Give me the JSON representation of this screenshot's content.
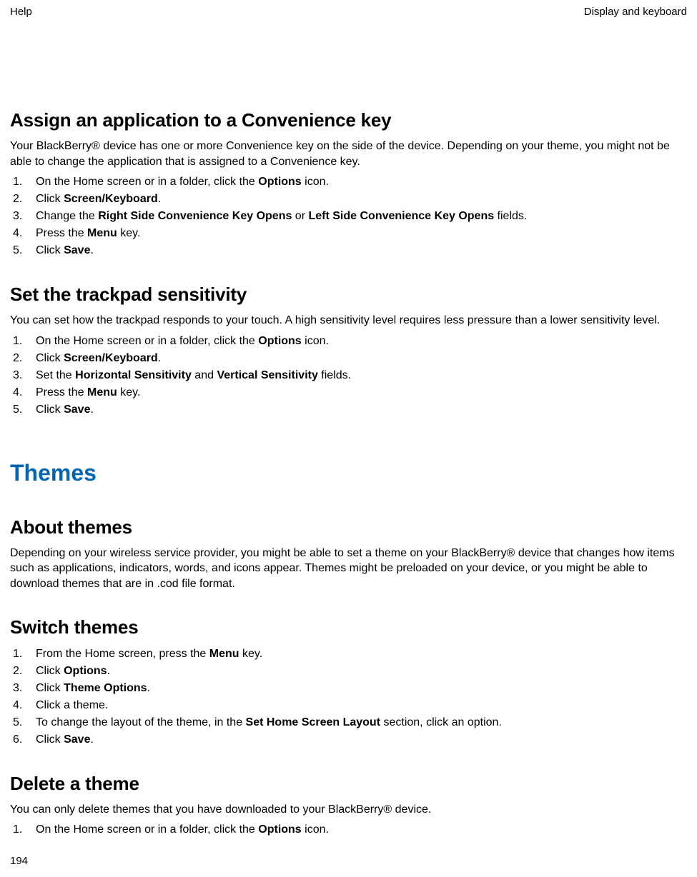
{
  "header": {
    "left": "Help",
    "right": "Display and keyboard"
  },
  "pageNumber": "194",
  "sections": {
    "assign": {
      "heading": "Assign an application to a Convenience key",
      "intro": "Your BlackBerry® device has one or more Convenience key on the side of the device. Depending on your theme, you might not be able to change the application that is assigned to a Convenience key.",
      "steps": {
        "s1a": "On the Home screen or in a folder, click the ",
        "s1b": "Options",
        "s1c": " icon.",
        "s2a": "Click ",
        "s2b": "Screen/Keyboard",
        "s2c": ".",
        "s3a": "Change the ",
        "s3b": "Right Side Convenience Key Opens",
        "s3c": " or ",
        "s3d": "Left Side Convenience Key Opens",
        "s3e": " fields.",
        "s4a": "Press the ",
        "s4b": "Menu",
        "s4c": " key.",
        "s5a": "Click ",
        "s5b": "Save",
        "s5c": "."
      }
    },
    "trackpad": {
      "heading": "Set the trackpad sensitivity",
      "intro": "You can set how the trackpad responds to your touch. A high sensitivity level requires less pressure than a lower sensitivity level.",
      "steps": {
        "s1a": "On the Home screen or in a folder, click the ",
        "s1b": "Options",
        "s1c": " icon.",
        "s2a": "Click ",
        "s2b": "Screen/Keyboard",
        "s2c": ".",
        "s3a": "Set the ",
        "s3b": "Horizontal Sensitivity",
        "s3c": " and ",
        "s3d": "Vertical Sensitivity",
        "s3e": " fields.",
        "s4a": "Press the ",
        "s4b": "Menu",
        "s4c": " key.",
        "s5a": "Click ",
        "s5b": "Save",
        "s5c": "."
      }
    },
    "themesTitle": "Themes",
    "aboutThemes": {
      "heading": "About themes",
      "intro": "Depending on your wireless service provider, you might be able to set a theme on your BlackBerry® device that changes how items such as applications, indicators, words, and icons appear. Themes might be preloaded on your device, or you might be able to download themes that are in .cod file format."
    },
    "switchThemes": {
      "heading": "Switch themes",
      "steps": {
        "s1a": "From the Home screen, press the ",
        "s1b": "Menu",
        "s1c": " key.",
        "s2a": "Click ",
        "s2b": "Options",
        "s2c": ".",
        "s3a": "Click ",
        "s3b": "Theme Options",
        "s3c": ".",
        "s4a": "Click a theme.",
        "s5a": "To change the layout of the theme, in the ",
        "s5b": "Set Home Screen Layout",
        "s5c": " section, click an option.",
        "s6a": "Click ",
        "s6b": "Save",
        "s6c": "."
      }
    },
    "deleteTheme": {
      "heading": "Delete a theme",
      "intro": "You can only delete themes that you have downloaded to your BlackBerry® device.",
      "steps": {
        "s1a": "On the Home screen or in a folder, click the ",
        "s1b": "Options",
        "s1c": " icon."
      }
    }
  }
}
